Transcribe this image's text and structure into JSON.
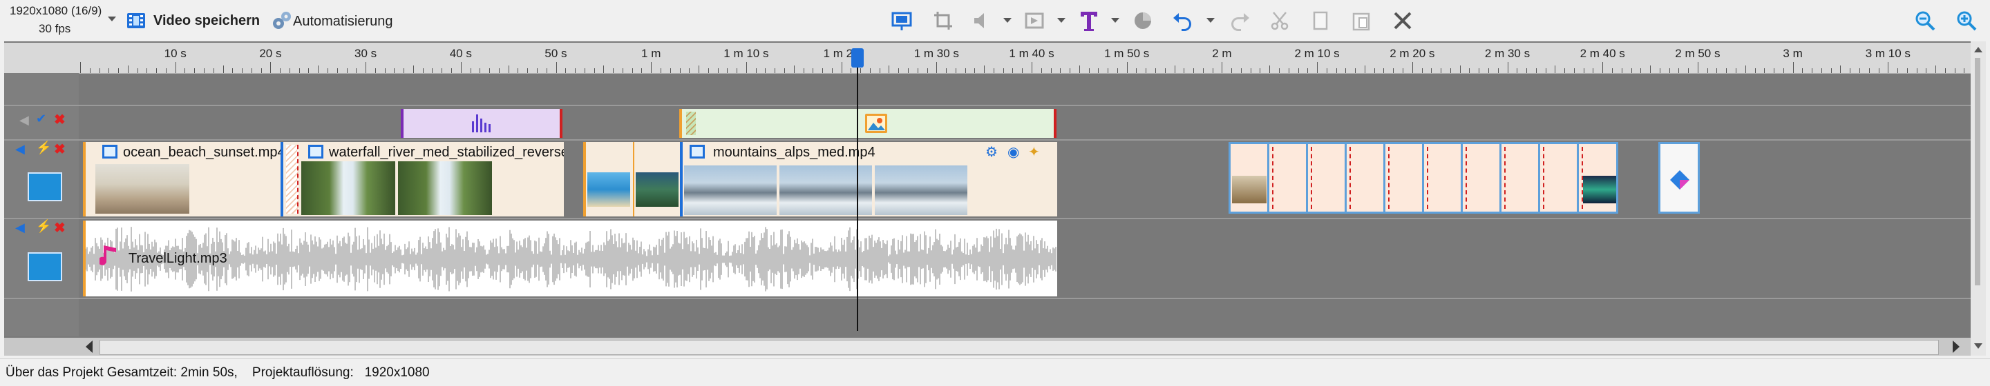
{
  "toolbar": {
    "resolution": "1920x1080 (16/9)",
    "fps": "30 fps",
    "save_video": "Video speichern",
    "automation": "Automatisierung"
  },
  "ruler": {
    "labels": [
      "10 s",
      "20 s",
      "30 s",
      "40 s",
      "50 s",
      "1 m",
      "1 m 10 s",
      "1 m 20",
      "1 m 30 s",
      "1 m 40 s",
      "1 m 50 s",
      "2 m",
      "2 m 10 s",
      "2 m 20 s",
      "2 m 30 s",
      "2 m 40 s",
      "2 m 50 s",
      "3 m",
      "3 m 10 s"
    ]
  },
  "clips": {
    "video1": "ocean_beach_sunset.mp4",
    "video2": "waterfall_river_med_stabilized_reverse...",
    "video3": "mountains_alps_med.mp4",
    "audio1": "TravelLight.mp3"
  },
  "status": {
    "text": "Über das Projekt Gesamtzeit: 2min 50s,    Projektauflösung:   1920x1080"
  },
  "colors": {
    "accent": "#1e6fd9",
    "timeline_bg": "#797979",
    "clip_bg": "#f7ecde",
    "mini_clip": "#fde9dc"
  },
  "icons": [
    "dropdown-arrow-icon",
    "film-save-icon",
    "automation-gears-icon",
    "screen-capture-icon",
    "crop-icon",
    "volume-icon",
    "transition-icon",
    "text-icon",
    "color-icon",
    "undo-icon",
    "redo-icon",
    "cut-icon",
    "copy-icon",
    "paste-icon",
    "delete-icon",
    "zoom-out-icon",
    "zoom-in-icon"
  ]
}
